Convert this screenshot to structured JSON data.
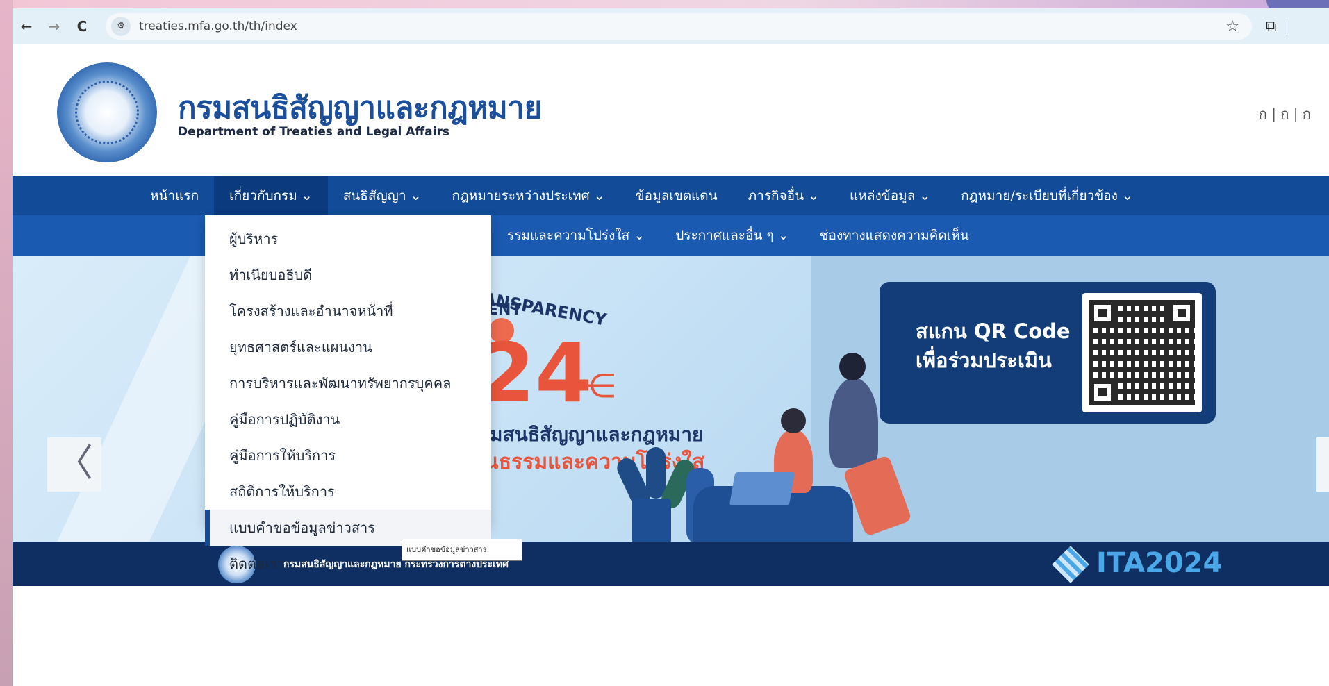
{
  "browser": {
    "url": "treaties.mfa.go.th/th/index",
    "back_icon": "←",
    "forward_icon": "→",
    "reload_icon": "C",
    "site_info_icon": "⚙",
    "bookmark_icon": "☆",
    "extension_icon": "⧉"
  },
  "header": {
    "title_th": "กรมสนธิสัญญาและกฎหมาย",
    "title_en": "Department of Treaties and Legal Affairs",
    "font_size_switch": "ก | ก | ก"
  },
  "nav": {
    "main": [
      {
        "label": "หน้าแรก"
      },
      {
        "label": "เกี่ยวกับกรม ⌄"
      },
      {
        "label": "สนธิสัญญา ⌄"
      },
      {
        "label": "กฎหมายระหว่างประเทศ ⌄"
      },
      {
        "label": "ข้อมูลเขตแดน"
      },
      {
        "label": "ภารกิจอื่น ⌄"
      },
      {
        "label": "แหล่งข้อมูล ⌄"
      },
      {
        "label": "กฎหมาย/ระเบียบที่เกี่ยวข้อง ⌄"
      }
    ],
    "sub": [
      {
        "label": "รรมและความโปร่งใส ⌄"
      },
      {
        "label": "ประกาศและอื่น ๆ ⌄"
      },
      {
        "label": "ช่องทางแสดงความคิดเห็น"
      }
    ]
  },
  "dropdown": {
    "items": [
      {
        "label": "ผู้บริหาร"
      },
      {
        "label": "ทำเนียบอธิบดี"
      },
      {
        "label": "โครงสร้างและอำนาจหน้าที่"
      },
      {
        "label": "ยุทธศาสตร์และแผนงาน"
      },
      {
        "label": "การบริหารและพัฒนาทรัพยากรบุคคล"
      },
      {
        "label": "คู่มือการปฏิบัติงาน"
      },
      {
        "label": "คู่มือการให้บริการ"
      },
      {
        "label": "สถิติการให้บริการ"
      },
      {
        "label": "แบบคำขอข้อมูลข่าวสาร"
      },
      {
        "label": "ติดต่อเรา"
      }
    ],
    "tooltip": "แบบคำขอข้อมูลข่าวสาร"
  },
  "banner": {
    "kicker": "ANSPARENCY",
    "kicker2": "ENT",
    "year": "24",
    "spark": "⋲",
    "line1": "รมสนธิสัญญาและกฎหมาย",
    "line2": "ณธรรมและความโปร่งใส",
    "qr_line1": "สแกน QR Code",
    "qr_line2": "เพื่อร่วมประเมิน",
    "prev_arrow": "〈"
  },
  "strip": {
    "text": "กรมสนธิสัญญาและกฎหมาย กระทรวงการต่างประเทศ",
    "ita": "ITA2024"
  },
  "colors": {
    "nav_bg": "#124b98",
    "subnav_bg": "#1a5ab1",
    "accent_orange": "#e8553c",
    "strip_bg": "#0f2f63"
  }
}
